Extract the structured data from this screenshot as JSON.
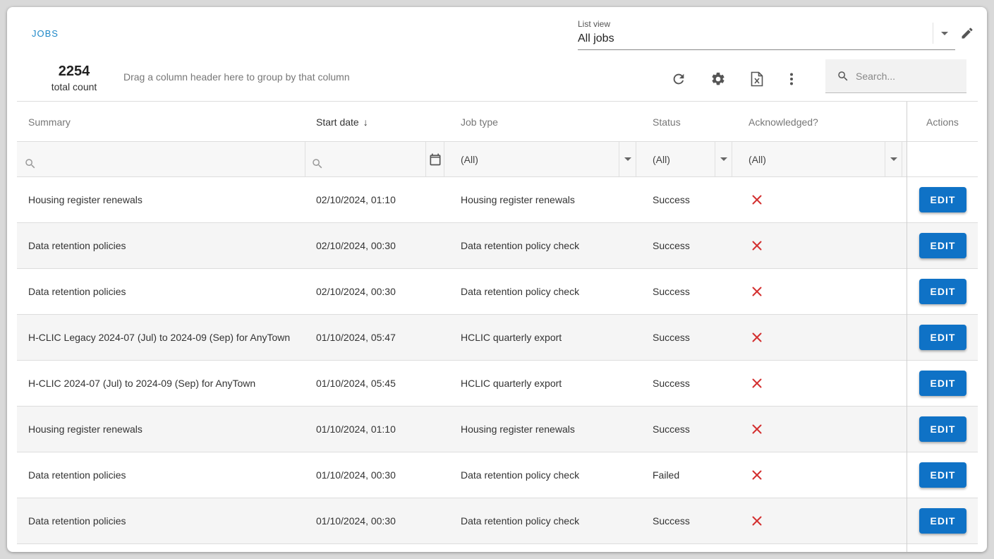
{
  "header": {
    "title": "Jobs",
    "list_view_label": "List view",
    "list_view_value": "All jobs",
    "total_count": "2254",
    "total_count_label": "total count",
    "group_hint": "Drag a column header here to group by that column",
    "search_placeholder": "Search..."
  },
  "columns": {
    "summary": "Summary",
    "start_date": "Start date",
    "job_type": "Job type",
    "status": "Status",
    "acknowledged": "Acknowledged?",
    "actions": "Actions",
    "sort_indicator": "↓"
  },
  "filters": {
    "job_type": "(All)",
    "status": "(All)",
    "acknowledged": "(All)"
  },
  "colors": {
    "accent": "#1e88c8",
    "button": "#0f72c6",
    "not_acknowledged": "#d32f2f"
  },
  "icons": [
    "chevron-down-icon",
    "pencil-icon",
    "refresh-icon",
    "gear-icon",
    "excel-export-icon",
    "more-vert-icon",
    "search-icon",
    "calendar-icon",
    "close-x-icon"
  ],
  "rows": [
    {
      "summary": "Housing register renewals",
      "start_date": "02/10/2024, 01:10",
      "job_type": "Housing register renewals",
      "status": "Success",
      "acknowledged": false,
      "action": "EDIT"
    },
    {
      "summary": "Data retention policies",
      "start_date": "02/10/2024, 00:30",
      "job_type": "Data retention policy check",
      "status": "Success",
      "acknowledged": false,
      "action": "EDIT"
    },
    {
      "summary": "Data retention policies",
      "start_date": "02/10/2024, 00:30",
      "job_type": "Data retention policy check",
      "status": "Success",
      "acknowledged": false,
      "action": "EDIT"
    },
    {
      "summary": "H-CLIC Legacy 2024-07 (Jul) to 2024-09 (Sep) for AnyTown",
      "start_date": "01/10/2024, 05:47",
      "job_type": "HCLIC quarterly export",
      "status": "Success",
      "acknowledged": false,
      "action": "EDIT"
    },
    {
      "summary": "H-CLIC 2024-07 (Jul) to 2024-09 (Sep) for AnyTown",
      "start_date": "01/10/2024, 05:45",
      "job_type": "HCLIC quarterly export",
      "status": "Success",
      "acknowledged": false,
      "action": "EDIT"
    },
    {
      "summary": "Housing register renewals",
      "start_date": "01/10/2024, 01:10",
      "job_type": "Housing register renewals",
      "status": "Success",
      "acknowledged": false,
      "action": "EDIT"
    },
    {
      "summary": "Data retention policies",
      "start_date": "01/10/2024, 00:30",
      "job_type": "Data retention policy check",
      "status": "Failed",
      "acknowledged": false,
      "action": "EDIT"
    },
    {
      "summary": "Data retention policies",
      "start_date": "01/10/2024, 00:30",
      "job_type": "Data retention policy check",
      "status": "Success",
      "acknowledged": false,
      "action": "EDIT"
    }
  ]
}
